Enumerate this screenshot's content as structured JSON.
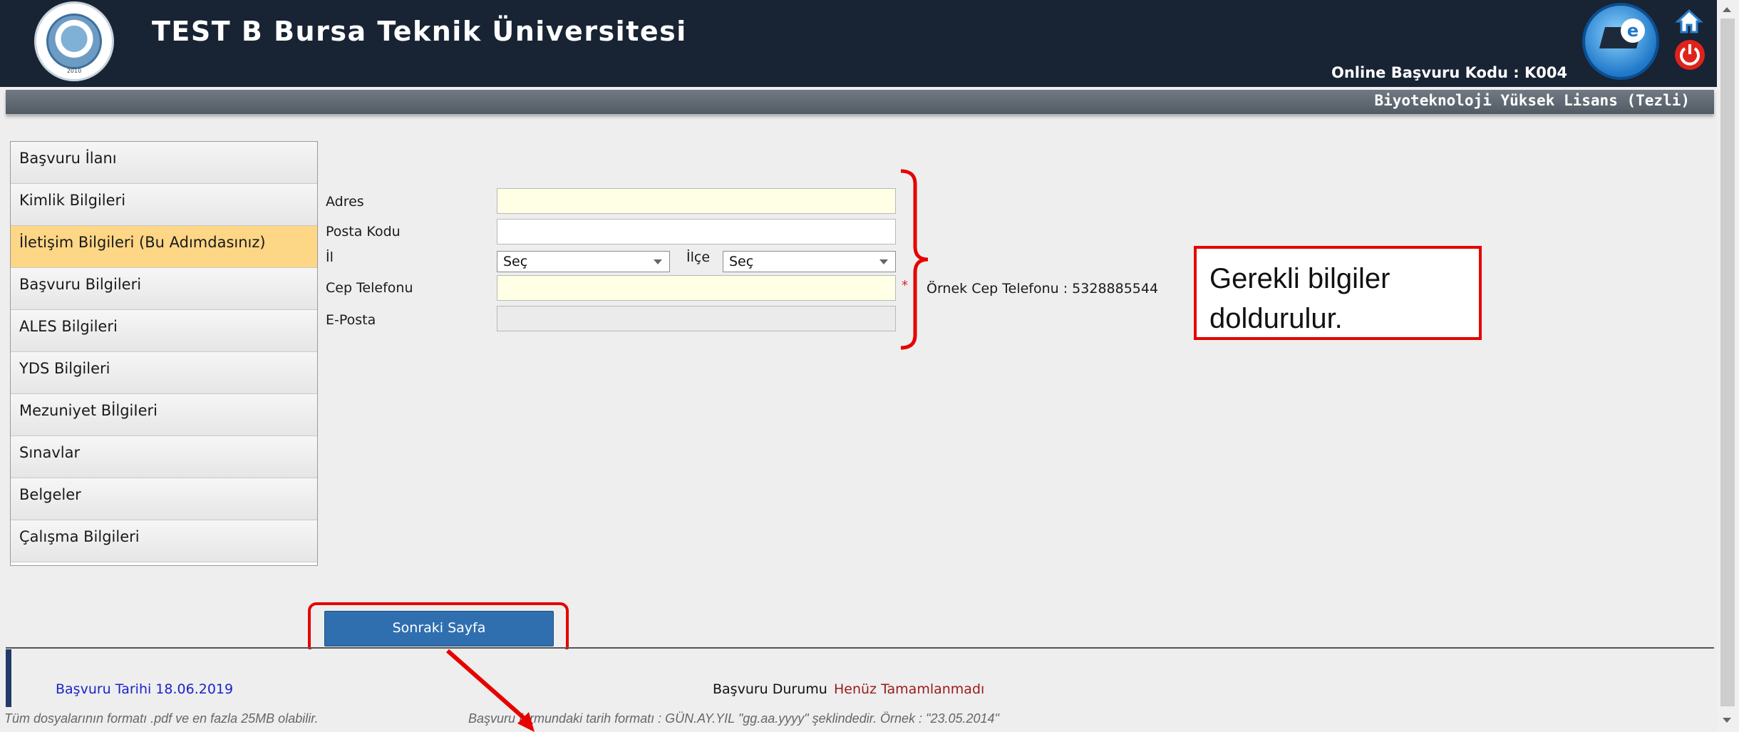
{
  "header": {
    "title": "TEST B Bursa Teknik Üniversitesi",
    "application_code": "Online Başvuru Kodu : K004",
    "logo_year": "2010"
  },
  "program": "Biyoteknoloji Yüksek Lisans (Tezli)",
  "sidebar": {
    "items": [
      {
        "label": "Başvuru İlanı"
      },
      {
        "label": "Kimlik Bilgileri"
      },
      {
        "label": "İletişim Bilgileri (Bu Adımdasınız)"
      },
      {
        "label": "Başvuru Bilgileri"
      },
      {
        "label": "ALES Bilgileri"
      },
      {
        "label": "YDS Bilgileri"
      },
      {
        "label": "Mezuniyet BİlgiIeri"
      },
      {
        "label": "Sınavlar"
      },
      {
        "label": "Belgeler"
      },
      {
        "label": "Çalışma Bilgileri"
      }
    ]
  },
  "form": {
    "address_label": "Adres",
    "postal_label": "Posta Kodu",
    "city_label": "İl",
    "city_value": "Seç",
    "district_label": "İlçe",
    "district_value": "Seç",
    "phone_label": "Cep Telefonu",
    "phone_required": "*",
    "phone_example": "Örnek Cep Telefonu : 5328885544",
    "email_label": "E-Posta"
  },
  "callout": {
    "text_line1": "Gerekli bilgiler",
    "text_line2": "doldurulur."
  },
  "buttons": {
    "next": "Sonraki Sayfa"
  },
  "footer": {
    "date": "Başvuru Tarihi  18.06.2019",
    "status_label": "Başvuru Durumu",
    "status_value": "Henüz Tamamlanmadı",
    "note_left": "Tüm dosyalarının formatı .pdf ve en fazla 25MB olabilir.",
    "note_right": "Başvuru formundaki tarih formatı : GÜN.AY.YIL \"gg.aa.yyyy\" şeklindedir. Örnek : \"23.05.2014\""
  },
  "colors": {
    "header_bg": "#182334",
    "active_item": "#fdd686",
    "button": "#2f6fb0",
    "annotation": "#e60000"
  }
}
